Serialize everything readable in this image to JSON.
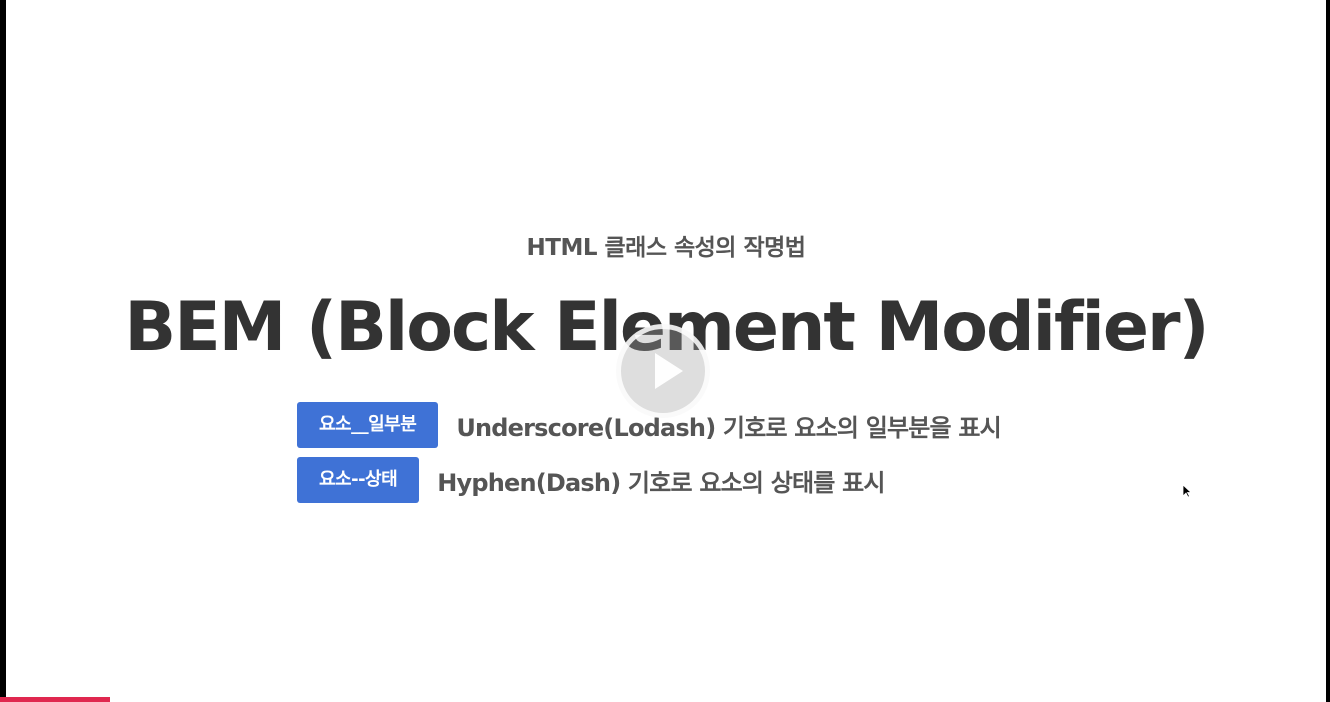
{
  "slide": {
    "subtitle": "HTML 클래스 속성의 작명법",
    "title": "BEM (Block Element Modifier)",
    "rows": [
      {
        "badge": "요소__일부분",
        "description": "Underscore(Lodash) 기호로 요소의 일부분을 표시"
      },
      {
        "badge": "요소--상태",
        "description": "Hyphen(Dash) 기호로 요소의 상태를 표시"
      }
    ]
  },
  "player": {
    "play_icon": "play-icon",
    "cursor_icon": "mouse-pointer-icon",
    "progress_fraction": 0.083,
    "progress_color": "#e0284f",
    "badge_color": "#3f72d6"
  }
}
